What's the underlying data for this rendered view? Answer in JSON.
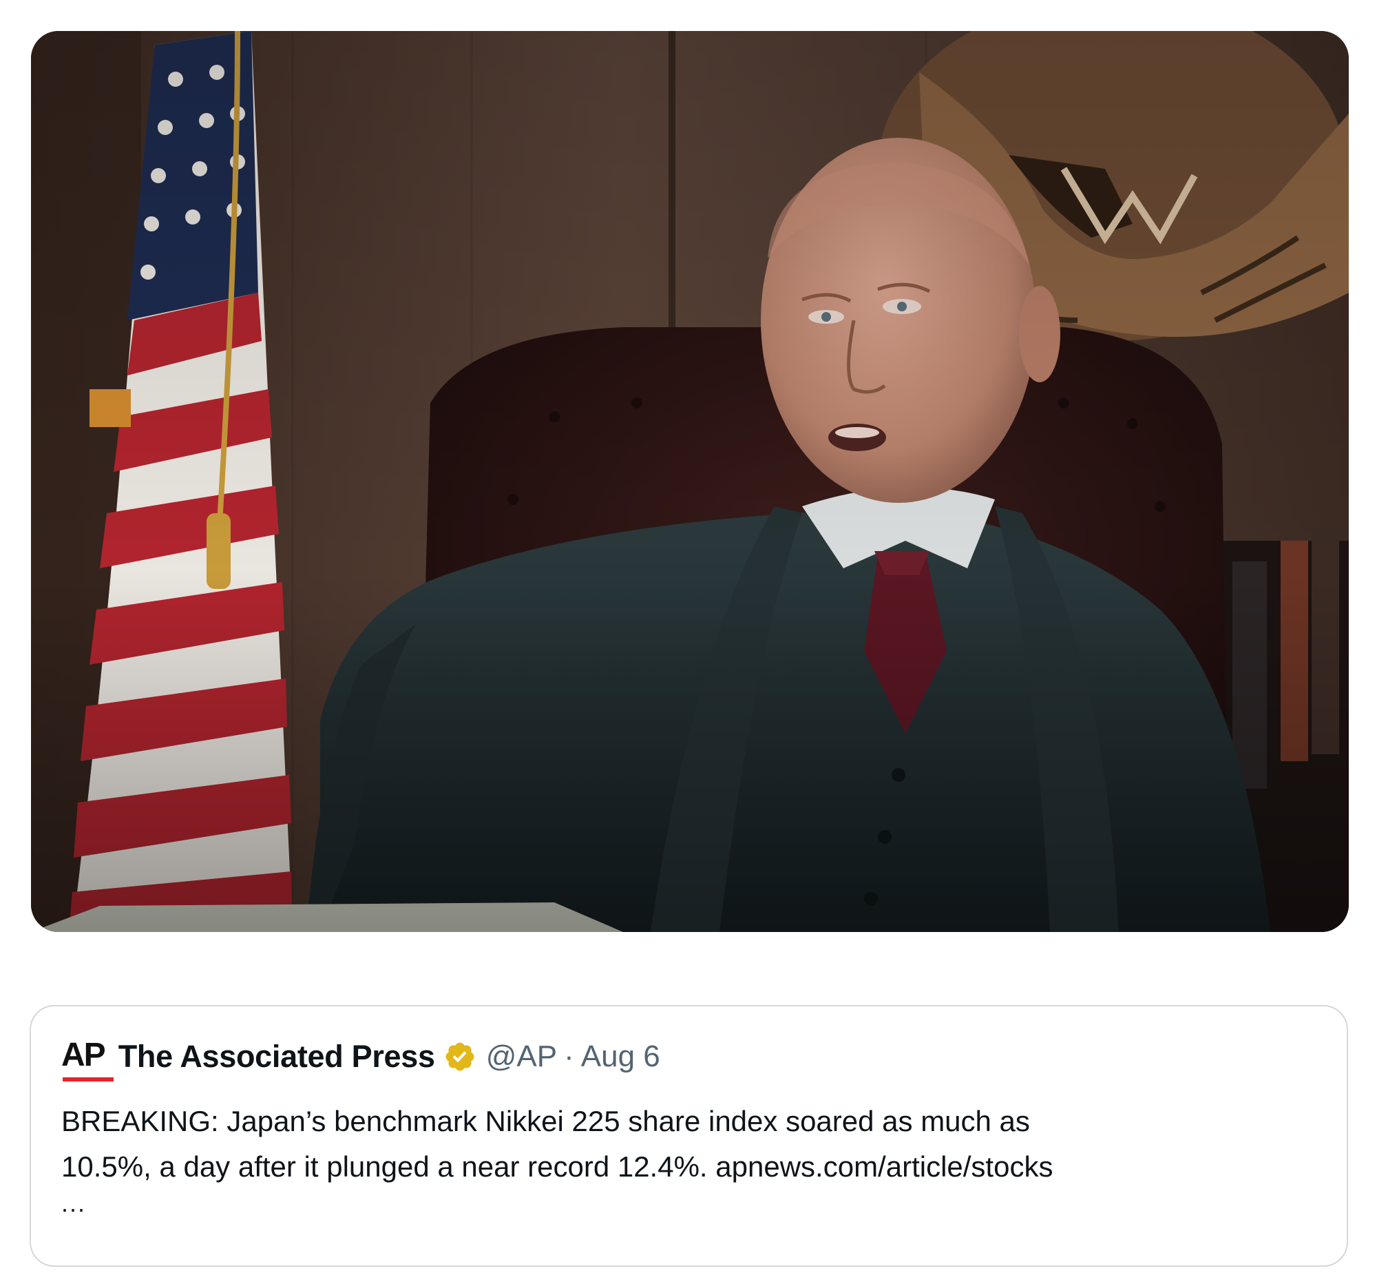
{
  "media": {
    "alt_icon": "photo-still-man-in-suit-at-desk"
  },
  "quote": {
    "logo_text": "AP",
    "author_name": "The Associated Press",
    "verified_icon": "verified-badge-gold",
    "handle": "@AP",
    "separator": "·",
    "date": "Aug 6",
    "text_line1": "BREAKING: Japan’s benchmark Nikkei 225 share index soared as much as",
    "text_line2_main": "10.5%, a day after it plunged a near record 12.4%. ",
    "text_link": "apnews.com/article/stocks",
    "ellipsis": "..."
  },
  "colors": {
    "accent_red": "#e4242b",
    "verified_gold": "#e2b719",
    "muted_text": "#536471",
    "card_border": "#d4d8db"
  }
}
